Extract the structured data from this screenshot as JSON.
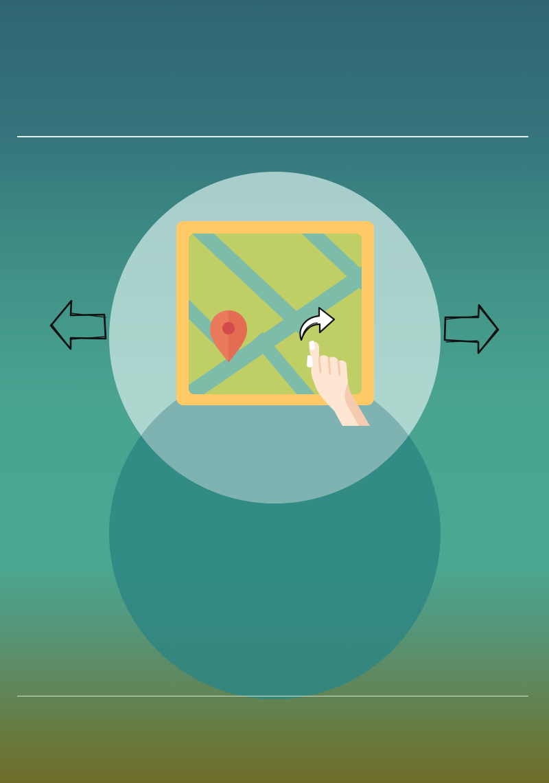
{
  "scene": {
    "background_top": "#2f6572",
    "background_mid": "#49a38f",
    "background_bottom": "#6e6c28"
  },
  "circles": {
    "upper_color": "#c8e4e0",
    "lower_color": "#2e8683"
  },
  "map": {
    "frame_color": "#ffc966",
    "land_color": "#bfcf66",
    "road_color": "#7ebcaa",
    "pin_color": "#ea7a5c",
    "pin_dot_color": "#d34a4a"
  },
  "hand": {
    "skin_color": "#fde6d2",
    "shade_color": "#f4cbb0",
    "cuff_color": "#ffffff"
  },
  "icons": [
    "arrow-left-icon",
    "arrow-right-icon",
    "map-icon",
    "location-pin-icon",
    "hand-pointer-icon",
    "curved-arrow-icon"
  ]
}
